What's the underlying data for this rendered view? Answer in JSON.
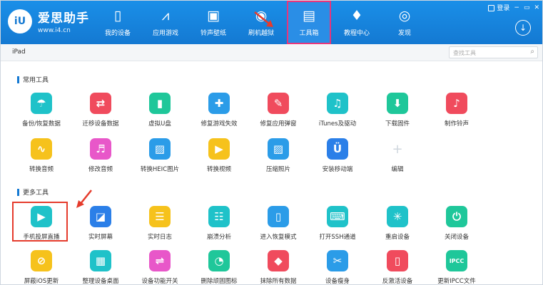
{
  "app": {
    "name": "爱思助手",
    "url": "www.i4.cn",
    "logo_mark": "iU"
  },
  "window": {
    "login": "登录",
    "minimize": "−",
    "restore": "▭",
    "close": "✕"
  },
  "nav": [
    {
      "label": "我的设备",
      "icon": "phone-icon",
      "glyph": "▯"
    },
    {
      "label": "应用游戏",
      "icon": "appstore-icon",
      "glyph": "⩘"
    },
    {
      "label": "铃声壁纸",
      "icon": "wallpaper-icon",
      "glyph": "▣"
    },
    {
      "label": "刷机越狱",
      "icon": "flash-icon",
      "glyph": "◉"
    },
    {
      "label": "工具箱",
      "icon": "toolbox-icon",
      "glyph": "▤"
    },
    {
      "label": "教程中心",
      "icon": "graduation-icon",
      "glyph": "♦"
    },
    {
      "label": "发现",
      "icon": "compass-icon",
      "glyph": "◎"
    }
  ],
  "active_nav": "工具箱",
  "device": {
    "name": "iPad"
  },
  "search": {
    "placeholder": "查找工具"
  },
  "sections": {
    "common": "常用工具",
    "more": "更多工具"
  },
  "common_tools": [
    {
      "label": "备份/恢复数据",
      "icon": "umbrella-icon",
      "glyph": "☂",
      "color": "#1fc2c9"
    },
    {
      "label": "迁移设备数据",
      "icon": "transfer-icon",
      "glyph": "⇄",
      "color": "#f04b5d"
    },
    {
      "label": "虚拟U盘",
      "icon": "usb-icon",
      "glyph": "▮",
      "color": "#1fc79a"
    },
    {
      "label": "修复游戏失效",
      "icon": "gamepad-icon",
      "glyph": "✚",
      "color": "#2b9ce8"
    },
    {
      "label": "修复应用弹窗",
      "icon": "repair-icon",
      "glyph": "✎",
      "color": "#f04b5d"
    },
    {
      "label": "iTunes及驱动",
      "icon": "music-icon",
      "glyph": "♫",
      "color": "#1fc2c9"
    },
    {
      "label": "下载固件",
      "icon": "download-icon",
      "glyph": "⬇",
      "color": "#1fc79a"
    },
    {
      "label": "制作铃声",
      "icon": "bell-icon",
      "glyph": "♪",
      "color": "#f04b5d"
    },
    {
      "label": "转换音频",
      "icon": "audio-icon",
      "glyph": "∿",
      "color": "#f6c21c"
    },
    {
      "label": "修改音频",
      "icon": "edit-audio-icon",
      "glyph": "♬",
      "color": "#e857c9"
    },
    {
      "label": "转换HEIC图片",
      "icon": "image-icon",
      "glyph": "▨",
      "color": "#2b9ce8"
    },
    {
      "label": "转换视频",
      "icon": "video-icon",
      "glyph": "▶",
      "color": "#f6c21c"
    },
    {
      "label": "压缩照片",
      "icon": "photo-icon",
      "glyph": "▨",
      "color": "#2b9ce8"
    },
    {
      "label": "安装移动端",
      "icon": "install-icon",
      "glyph": "Ü",
      "color": "#2b7fe8"
    },
    {
      "label": "编辑",
      "icon": "plus-icon",
      "glyph": "+",
      "color": "transparent"
    }
  ],
  "more_tools": [
    {
      "label": "手机投屏直播",
      "icon": "cast-icon",
      "glyph": "▶",
      "color": "#1fc2c9"
    },
    {
      "label": "实时屏幕",
      "icon": "screen-icon",
      "glyph": "◪",
      "color": "#2b7fe8"
    },
    {
      "label": "实时日志",
      "icon": "log-icon",
      "glyph": "☰",
      "color": "#f6c21c"
    },
    {
      "label": "崩溃分析",
      "icon": "crash-icon",
      "glyph": "☷",
      "color": "#1fc2c9"
    },
    {
      "label": "进入恢复模式",
      "icon": "recovery-icon",
      "glyph": "▯",
      "color": "#2b9ce8"
    },
    {
      "label": "打开SSH通道",
      "icon": "ssh-icon",
      "glyph": "⌨",
      "color": "#1fc2c9"
    },
    {
      "label": "重启设备",
      "icon": "restart-icon",
      "glyph": "✳",
      "color": "#1fc2c9"
    },
    {
      "label": "关闭设备",
      "icon": "power-icon",
      "glyph": "⏻",
      "color": "#1fc79a"
    },
    {
      "label": "屏蔽iOS更新",
      "icon": "block-update-icon",
      "glyph": "⊘",
      "color": "#f6c21c"
    },
    {
      "label": "整理设备桌面",
      "icon": "desktop-icon",
      "glyph": "▦",
      "color": "#1fc2c9"
    },
    {
      "label": "设备功能开关",
      "icon": "switch-icon",
      "glyph": "⇌",
      "color": "#e857c9"
    },
    {
      "label": "删除顽固图标",
      "icon": "delete-icon-icon",
      "glyph": "◔",
      "color": "#1fc79a"
    },
    {
      "label": "抹除所有数据",
      "icon": "erase-icon",
      "glyph": "◆",
      "color": "#f04b5d"
    },
    {
      "label": "设备瘦身",
      "icon": "broom-icon",
      "glyph": "✂",
      "color": "#2b9ce8"
    },
    {
      "label": "反激活设备",
      "icon": "deactivate-icon",
      "glyph": "▯",
      "color": "#f04b5d"
    },
    {
      "label": "更新IPCC文件",
      "icon": "ipcc-icon",
      "glyph": "IPCC",
      "color": "#1fc79a"
    }
  ]
}
